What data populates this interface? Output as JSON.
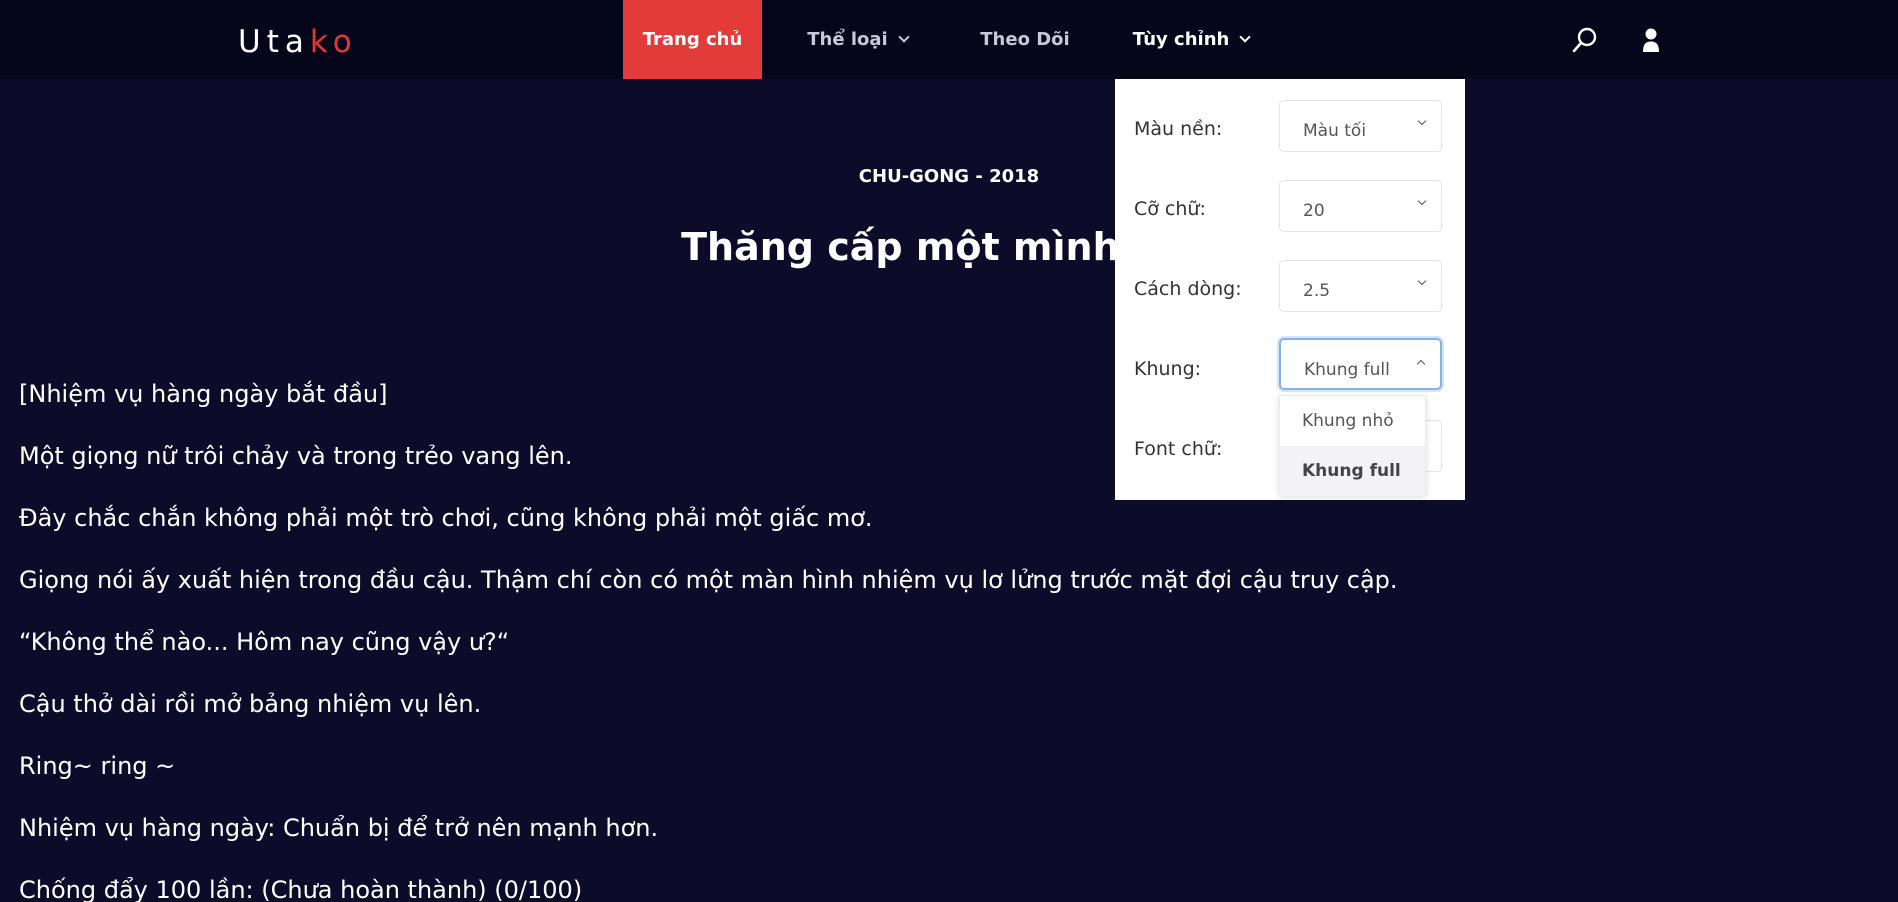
{
  "header": {
    "logo": {
      "part1": "Uta",
      "part2": "k",
      "part3": "o"
    },
    "nav": [
      {
        "label": "Trang chủ"
      },
      {
        "label": "Thể loại"
      },
      {
        "label": "Theo Dõi"
      },
      {
        "label": "Tùy chỉnh"
      }
    ],
    "icons": [
      "search-icon",
      "user-icon"
    ]
  },
  "chapter": {
    "source": "CHU-GONG - 2018",
    "title": "Thăng cấp một mình - Ch",
    "paragraphs": [
      "[Nhiệm vụ hàng ngày bắt đầu]",
      "Một giọng nữ trôi chảy và trong trẻo vang lên.",
      "Đây chắc chắn không phải một trò chơi, cũng không phải một giấc mơ.",
      "Giọng nói ấy xuất hiện trong đầu cậu. Thậm chí còn có một màn hình nhiệm vụ lơ lửng trước mặt đợi cậu truy cập.",
      "“Không thể nào... Hôm nay cũng vậy ư?“",
      "Cậu thở dài rồi mở bảng nhiệm vụ lên.",
      "Ring~ ring ~",
      "Nhiệm vụ hàng ngày: Chuẩn bị để trở nên mạnh hơn.",
      "Chống đẩy 100 lần: (Chưa hoàn thành) (0/100)"
    ]
  },
  "settings": {
    "background": {
      "label": "Màu nền:",
      "value": "Màu tối"
    },
    "font_size": {
      "label": "Cỡ chữ:",
      "value": "20"
    },
    "line_height": {
      "label": "Cách dòng:",
      "value": "2.5"
    },
    "frame": {
      "label": "Khung:",
      "value": "Khung full",
      "options": [
        "Khung nhỏ",
        "Khung full"
      ]
    },
    "font": {
      "label": "Font chữ:"
    }
  },
  "colors": {
    "accent": "#e33a3a",
    "background": "#0c0c2a",
    "header": "#06061a"
  }
}
